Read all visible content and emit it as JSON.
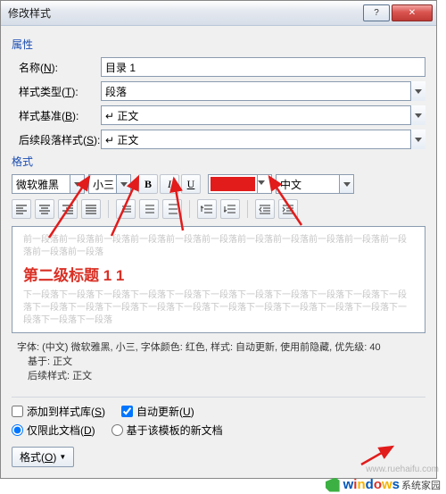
{
  "title": "修改样式",
  "help_glyph": "?",
  "close_glyph": "✕",
  "section_props": "属性",
  "section_format": "格式",
  "labels": {
    "name": "名称(",
    "name_u": "N",
    "name_end": "):",
    "styletype": "样式类型(",
    "styletype_u": "T",
    "styletype_end": "):",
    "basedon": "样式基准(",
    "basedon_u": "B",
    "basedon_end": "):",
    "following": "后续段落样式(",
    "following_u": "S",
    "following_end": "):"
  },
  "fields": {
    "name": "目录 1",
    "styletype": "段落",
    "basedon": "↵ 正文",
    "following": "↵ 正文"
  },
  "format": {
    "font": "微软雅黑",
    "size": "小三",
    "bold": "B",
    "italic": "I",
    "underline": "U",
    "color": "#e21b1b",
    "lang": "中文"
  },
  "preview": {
    "gray": "前一段落前一段落前一段落前一段落前一段落前一段落前一段落前一段落前一段落前一段落前一段落前一段落前一段落",
    "main": "第二级标题 1 1",
    "gray2": "下一段落下一段落下一段落下一段落下一段落下一段落下一段落下一段落下一段落下一段落下一段落下一段落下一段落下一段落下一段落下一段落下一段落下一段落下一段落下一段落下一段落下一段落下一段落下一段落"
  },
  "desc": {
    "line1": "字体: (中文) 微软雅黑, 小三, 字体颜色: 红色, 样式: 自动更新, 使用前隐藏, 优先级: 40",
    "line2": "基于: 正文",
    "line3": "后续样式: 正文"
  },
  "checks": {
    "add": "添加到样式库(",
    "add_u": "S",
    "add_end": ")",
    "auto": "自动更新(",
    "auto_u": "U",
    "auto_end": ")"
  },
  "radios": {
    "thisdoc": "仅限此文档(",
    "thisdoc_u": "D",
    "thisdoc_end": ")",
    "template": "基于该模板的新文档"
  },
  "format_btn": {
    "label": "格式(",
    "u": "O",
    "end": ")"
  },
  "watermark": {
    "text1": "windows",
    "text2": "系统家园",
    "url": "www.ruehaifu.com"
  }
}
